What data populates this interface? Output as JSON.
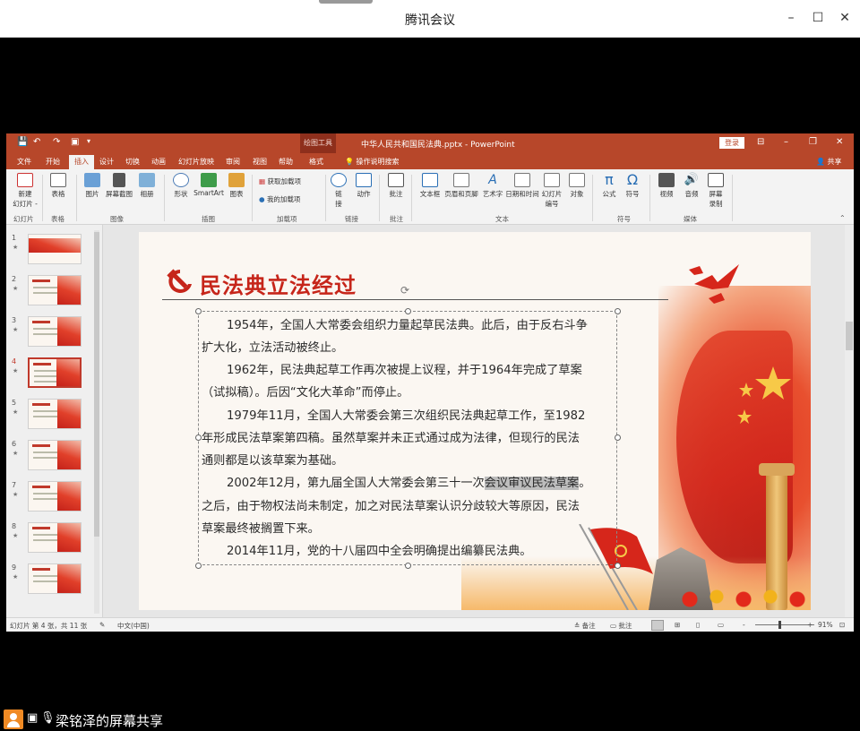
{
  "window": {
    "title": "腾讯会议",
    "minimize": "–",
    "maximize": "☐",
    "close": "✕"
  },
  "ppt": {
    "doc_title": "中华人民共和国民法典.pptx - PowerPoint",
    "draw_tools": "绘图工具",
    "login": "登录",
    "tell_me": "操作说明搜索",
    "share": "共享",
    "tabs": [
      "文件",
      "开始",
      "插入",
      "设计",
      "切换",
      "动画",
      "幻灯片放映",
      "审阅",
      "视图",
      "帮助",
      "格式"
    ],
    "active_tab": "插入",
    "ribbon": {
      "buttons": [
        {
          "name": "new-slide",
          "label": "新建\n幻灯片 -",
          "icon": "new-slide-icon"
        },
        {
          "name": "table",
          "label": "表格",
          "icon": "table-icon"
        },
        {
          "name": "picture",
          "label": "图片",
          "icon": "picture-icon"
        },
        {
          "name": "screenshot",
          "label": "屏幕截图",
          "icon": "screenshot-icon"
        },
        {
          "name": "album",
          "label": "相册",
          "icon": "album-icon"
        },
        {
          "name": "shapes",
          "label": "形状",
          "icon": "shapes-icon"
        },
        {
          "name": "smartart",
          "label": "SmartArt",
          "icon": "smartart-icon"
        },
        {
          "name": "chart",
          "label": "图表",
          "icon": "chart-icon"
        },
        {
          "name": "get-addins",
          "label": "获取加载项",
          "icon": "store-icon"
        },
        {
          "name": "my-addins",
          "label": "我的加载项",
          "icon": "addins-icon"
        },
        {
          "name": "link",
          "label": "链\n接",
          "icon": "link-icon"
        },
        {
          "name": "action",
          "label": "动作",
          "icon": "action-icon"
        },
        {
          "name": "comment",
          "label": "批注",
          "icon": "comment-icon"
        },
        {
          "name": "textbox",
          "label": "文本框",
          "icon": "textbox-icon"
        },
        {
          "name": "header-footer",
          "label": "页眉和页脚",
          "icon": "header-footer-icon"
        },
        {
          "name": "wordart",
          "label": "艺术字",
          "icon": "wordart-icon"
        },
        {
          "name": "date-time",
          "label": "日期和时间",
          "icon": "date-icon"
        },
        {
          "name": "slide-number",
          "label": "幻灯片\n编号",
          "icon": "slide-number-icon"
        },
        {
          "name": "object",
          "label": "对象",
          "icon": "object-icon"
        },
        {
          "name": "equation",
          "label": "公式",
          "icon": "pi-icon"
        },
        {
          "name": "symbol",
          "label": "符号",
          "icon": "omega-icon"
        },
        {
          "name": "video",
          "label": "视频",
          "icon": "video-icon"
        },
        {
          "name": "audio",
          "label": "音频",
          "icon": "audio-icon"
        },
        {
          "name": "screen-record",
          "label": "屏幕\n录制",
          "icon": "screen-record-icon"
        }
      ],
      "groups": [
        "幻灯片",
        "表格",
        "图像",
        "插图",
        "加载项",
        "链接",
        "批注",
        "文本",
        "符号",
        "媒体"
      ]
    },
    "thumbnails": [
      {
        "num": "1",
        "star": "★"
      },
      {
        "num": "2",
        "star": "★"
      },
      {
        "num": "3",
        "star": "★"
      },
      {
        "num": "4",
        "star": "★"
      },
      {
        "num": "5",
        "star": "★"
      },
      {
        "num": "6",
        "star": "★"
      },
      {
        "num": "7",
        "star": "★"
      },
      {
        "num": "8",
        "star": "★"
      },
      {
        "num": "9",
        "star": "★"
      }
    ],
    "active_slide": 4,
    "slide": {
      "title": "民法典立法经过",
      "p1a": "1954年，全国人大常委会组织力量起草民法典。此后，由于反右斗争",
      "p1b": "扩大化，立法活动被终止。",
      "p2a": "1962年，民法典起草工作再次被提上议程，并于1964年完成了草案",
      "p2b": "（试拟稿）。后因“文化大革命”而停止。",
      "p3a": "1979年11月，全国人大常委会第三次组织民法典起草工作，至1982",
      "p3b": "年形成民法草案第四稿。虽然草案并未正式通过成为法律，但现行的民法",
      "p3c": "通则都是以该草案为基础。",
      "p4a_pre": "2002年12月，第九届全国人大常委会第三十一次",
      "p4a_hl": "会议审议民法草案",
      "p4a_post": "。",
      "p4b": "之后，由于物权法尚未制定，加之对民法草案认识分歧较大等原因，民法",
      "p4c": "草案最终被搁置下来。",
      "p5a": "2014年11月，党的十八届四中全会明确提出编纂民法典。"
    },
    "status": {
      "slide_info": "幻灯片 第 4 张，共 11 张",
      "language": "中文(中国)",
      "notes": "备注",
      "comments": "批注",
      "zoom_minus": "-",
      "zoom_plus": "+",
      "zoom": "91%"
    }
  },
  "share_banner": {
    "label": "梁铭泽的屏幕共享"
  },
  "colors": {
    "ppt_red": "#b7472a",
    "slide_title": "#c6251a",
    "ribbon_bg": "#f3f3f3"
  }
}
